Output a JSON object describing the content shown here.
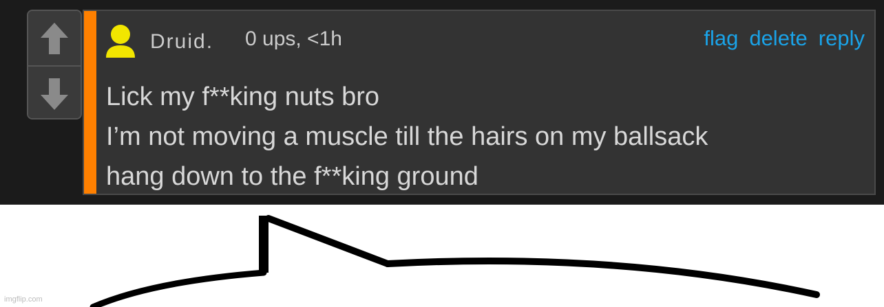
{
  "vote": {
    "up_icon": "arrow-up-icon",
    "down_icon": "arrow-down-icon"
  },
  "comment": {
    "username": "Druid.",
    "meta": "0 ups, <1h",
    "actions": {
      "flag": "flag",
      "delete": "delete",
      "reply": "reply"
    },
    "body": [
      "Lick my f**king nuts bro",
      "I’m not moving a muscle till the hairs on my ballsack",
      "hang down to the f**king ground"
    ],
    "accent_color": "#ff8000",
    "avatar_color": "#f2e600",
    "link_color": "#1aa3e8",
    "avatar_icon": "user-avatar-icon"
  },
  "watermark": "imgflip.com"
}
